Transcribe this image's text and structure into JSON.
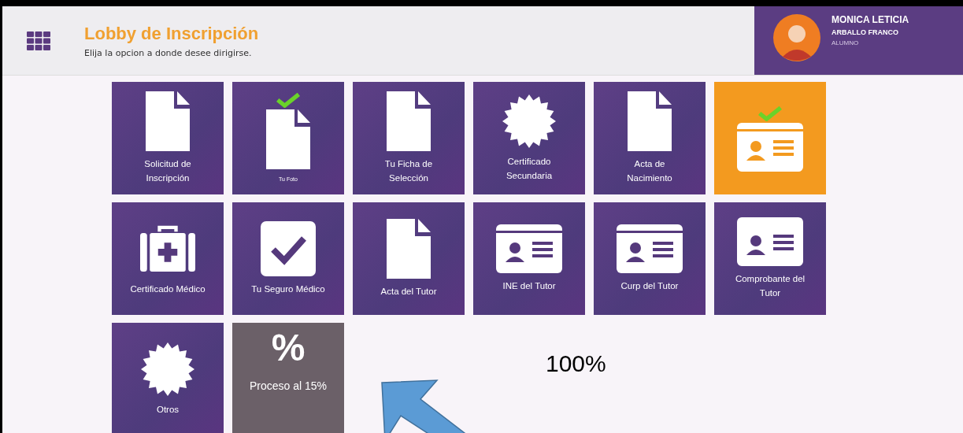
{
  "header": {
    "title": "Lobby de Inscripción",
    "subtitle": "Elija la opcion a donde desee dirigirse."
  },
  "user": {
    "name": "MONICA LETICIA",
    "surname": "ARBALLO FRANCO",
    "role": "ALUMNO"
  },
  "tiles": [
    {
      "kind": "document",
      "label": "Solicitud de Inscripción",
      "checked": false,
      "selected": false,
      "small": false
    },
    {
      "kind": "document",
      "label": "Tu Foto",
      "checked": true,
      "selected": false,
      "small": true
    },
    {
      "kind": "document",
      "label": "Tu Ficha de Selección",
      "checked": false,
      "selected": false,
      "small": false
    },
    {
      "kind": "seal",
      "label": "Certificado Secundaria",
      "checked": false,
      "selected": false,
      "small": false
    },
    {
      "kind": "document",
      "label": "Acta de Nacimiento",
      "checked": false,
      "selected": false,
      "small": false
    },
    {
      "kind": "idcard",
      "checked": true,
      "selected": true
    },
    {
      "kind": "medkit",
      "label": "Certificado Médico",
      "checked": false,
      "selected": false,
      "small": false
    },
    {
      "kind": "checkbox",
      "label": "Tu Seguro Médico",
      "checked": false,
      "selected": false,
      "small": false
    },
    {
      "kind": "document",
      "label": "Acta del Tutor",
      "checked": false,
      "selected": false,
      "small": false
    },
    {
      "kind": "idcard",
      "label": "INE del Tutor",
      "checked": false,
      "selected": false,
      "small": false
    },
    {
      "kind": "idcard",
      "label": "Curp del Tutor",
      "checked": false,
      "selected": false,
      "small": false
    },
    {
      "kind": "person",
      "label": "Comprobante del Tutor",
      "checked": false,
      "selected": false,
      "small": false
    },
    {
      "kind": "seal",
      "label": "Otros",
      "checked": false,
      "selected": false,
      "small": false
    },
    {
      "kind": "percent",
      "glyph": "%",
      "label": "Proceso al 15%",
      "checked": false,
      "selected": false,
      "small": false
    }
  ],
  "annotation": {
    "text": "100%"
  }
}
